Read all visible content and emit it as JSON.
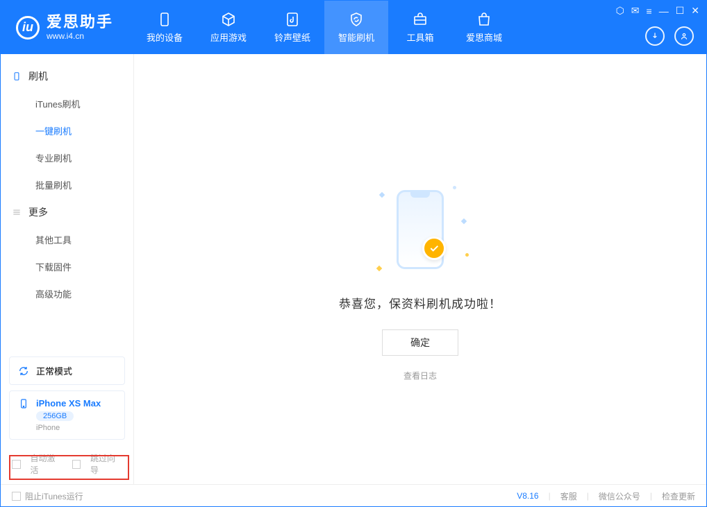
{
  "app": {
    "title": "爱思助手",
    "subtitle": "www.i4.cn"
  },
  "nav": {
    "items": [
      {
        "label": "我的设备"
      },
      {
        "label": "应用游戏"
      },
      {
        "label": "铃声壁纸"
      },
      {
        "label": "智能刷机"
      },
      {
        "label": "工具箱"
      },
      {
        "label": "爱思商城"
      }
    ]
  },
  "sidebar": {
    "section1_title": "刷机",
    "items1": [
      "iTunes刷机",
      "一键刷机",
      "专业刷机",
      "批量刷机"
    ],
    "section2_title": "更多",
    "items2": [
      "其他工具",
      "下载固件",
      "高级功能"
    ],
    "mode_label": "正常模式",
    "device": {
      "name": "iPhone XS Max",
      "storage": "256GB",
      "type": "iPhone"
    },
    "checkboxes": {
      "auto_activate": "自动激活",
      "skip_guide": "跳过向导"
    }
  },
  "main": {
    "success_msg": "恭喜您，保资料刷机成功啦！",
    "ok_label": "确定",
    "log_link": "查看日志"
  },
  "statusbar": {
    "block_itunes": "阻止iTunes运行",
    "version": "V8.16",
    "links": [
      "客服",
      "微信公众号",
      "检查更新"
    ]
  }
}
